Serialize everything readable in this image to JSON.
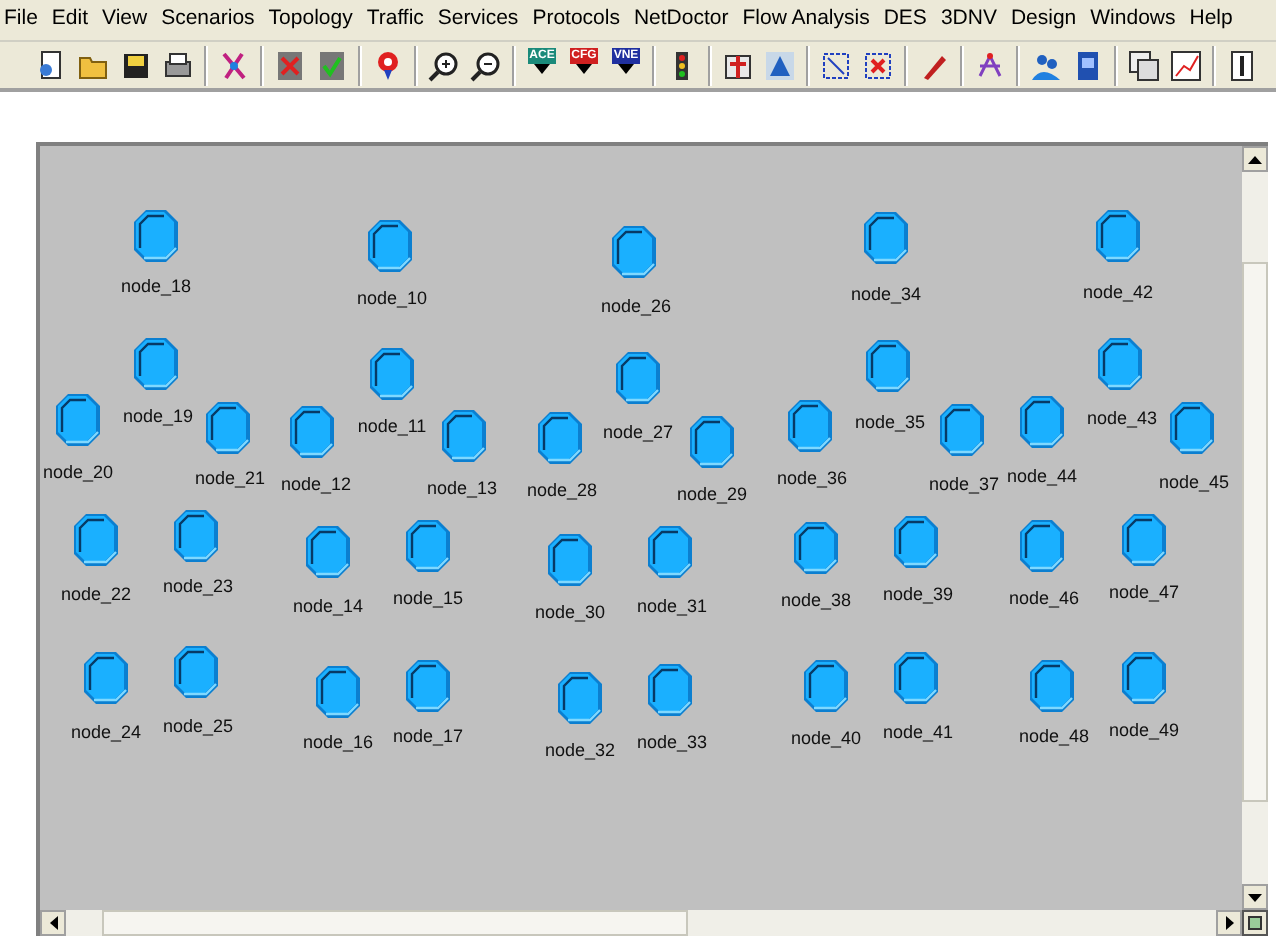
{
  "menu_bar": [
    "File",
    "Edit",
    "View",
    "Scenarios",
    "Topology",
    "Traffic",
    "Services",
    "Protocols",
    "NetDoctor",
    "Flow Analysis",
    "DES",
    "3DNV",
    "Design",
    "Windows",
    "Help"
  ],
  "toolbar": {
    "badges": [
      "ACE",
      "CFG",
      "VNE"
    ]
  },
  "nodes": [
    {
      "label": "node_18"
    },
    {
      "label": "node_10"
    },
    {
      "label": "node_26"
    },
    {
      "label": "node_34"
    },
    {
      "label": "node_42"
    },
    {
      "label": "node_19"
    },
    {
      "label": "node_11"
    },
    {
      "label": "node_27"
    },
    {
      "label": "node_35"
    },
    {
      "label": "node_43"
    },
    {
      "label": "node_20"
    },
    {
      "label": "node_21"
    },
    {
      "label": "node_12"
    },
    {
      "label": "node_13"
    },
    {
      "label": "node_28"
    },
    {
      "label": "node_29"
    },
    {
      "label": "node_36"
    },
    {
      "label": "node_37"
    },
    {
      "label": "node_44"
    },
    {
      "label": "node_45"
    },
    {
      "label": "node_22"
    },
    {
      "label": "node_23"
    },
    {
      "label": "node_14"
    },
    {
      "label": "node_15"
    },
    {
      "label": "node_30"
    },
    {
      "label": "node_31"
    },
    {
      "label": "node_38"
    },
    {
      "label": "node_39"
    },
    {
      "label": "node_46"
    },
    {
      "label": "node_47"
    },
    {
      "label": "node_24"
    },
    {
      "label": "node_25"
    },
    {
      "label": "node_16"
    },
    {
      "label": "node_17"
    },
    {
      "label": "node_32"
    },
    {
      "label": "node_33"
    },
    {
      "label": "node_40"
    },
    {
      "label": "node_41"
    },
    {
      "label": "node_48"
    },
    {
      "label": "node_49"
    }
  ]
}
